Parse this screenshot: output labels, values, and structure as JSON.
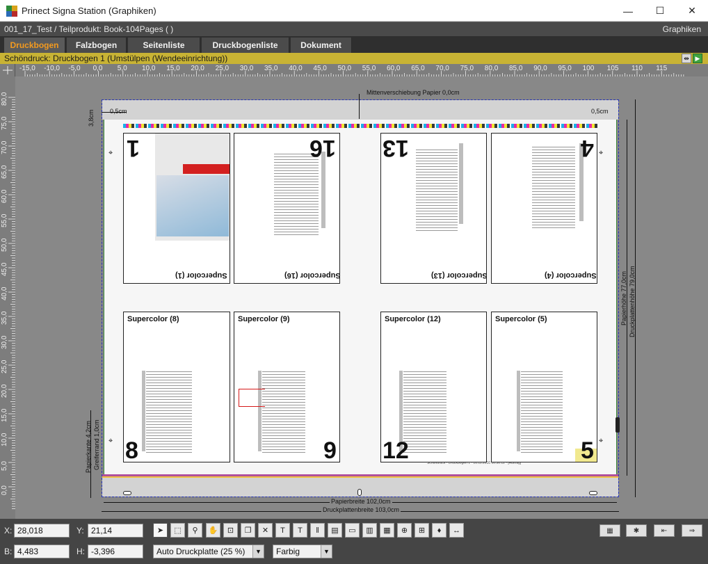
{
  "window": {
    "title": "Prinect Signa Station (Graphiken)",
    "minimize": "—",
    "maximize": "☐",
    "close": "✕"
  },
  "pathbar": {
    "path": "001_17_Test / Teilprodukt: Book-104Pages (  )",
    "module": "Graphiken"
  },
  "tabs": [
    {
      "label": "Druckbogen",
      "active": true
    },
    {
      "label": "Falzbogen",
      "active": false
    },
    {
      "label": "Seitenliste",
      "active": false
    },
    {
      "label": "Druckbogenliste",
      "active": false
    },
    {
      "label": "Dokument",
      "active": false
    }
  ],
  "status": {
    "text": "Schöndruck:  Druckbogen 1 (Umstülpen (Wendeeinrichtung))"
  },
  "ruler_h": [
    "-15,0",
    "-10,0",
    "-5,0",
    "0,0",
    "5,0",
    "10,0",
    "15,0",
    "20,0",
    "25,0",
    "30,0",
    "35,0",
    "40,0",
    "45,0",
    "50,0",
    "55,0",
    "60,0",
    "65,0",
    "70,0",
    "75,0",
    "80,0",
    "85,0",
    "90,0",
    "95,0",
    "100",
    "105",
    "110",
    "115"
  ],
  "ruler_v": [
    "80,0",
    "75,0",
    "70,0",
    "65,0",
    "60,0",
    "55,0",
    "50,0",
    "45,0",
    "40,0",
    "35,0",
    "30,0",
    "25,0",
    "20,0",
    "15,0",
    "10,0",
    "5,0",
    "0,0"
  ],
  "sheet": {
    "center_offset": "Mittenverschiebung Papier 0,0cm",
    "margin_left": "0,5cm",
    "margin_right": "0,5cm",
    "margin_top": "3,8cm",
    "paper_height": "Papierhöhe 77,0cm",
    "plate_height": "Druckplattenhöhe 79,0cm",
    "paper_width": "Papierbreite 102,0cm",
    "plate_width": "Druckplattenbreite 103,0cm",
    "paper_bottom": "Papierkante 4,2cm",
    "gripper": "Greiferrand 1,0cm",
    "footer_slug": "Schöndruck  ·  Druckbogen 1 · 10.11.2016 10:30:12 · [Auftrag]"
  },
  "pages": [
    {
      "title": "Supercolor (1)",
      "number": "1",
      "flipped": true
    },
    {
      "title": "Supercolor (16)",
      "number": "16",
      "flipped": true
    },
    {
      "title": "Supercolor (13)",
      "number": "13",
      "flipped": true
    },
    {
      "title": "Supercolor (4)",
      "number": "4",
      "flipped": true
    },
    {
      "title": "Supercolor (8)",
      "number": "8",
      "flipped": false
    },
    {
      "title": "Supercolor (9)",
      "number": "9",
      "flipped": false
    },
    {
      "title": "Supercolor (12)",
      "number": "12",
      "flipped": false
    },
    {
      "title": "Supercolor (5)",
      "number": "5",
      "flipped": false
    }
  ],
  "bottom": {
    "x_label": "X:",
    "x_value": "28,018",
    "y_label": "Y:",
    "y_value": "21,14",
    "b_label": "B:",
    "b_value": "4,483",
    "h_label": "H:",
    "h_value": "-3,396",
    "plate_select": "Auto Druckplatte (25 %)",
    "color_select": "Farbig"
  },
  "colors": {
    "accent_tab": "#f39a1f",
    "status_bar": "#c8b334",
    "workspace": "#888888"
  }
}
